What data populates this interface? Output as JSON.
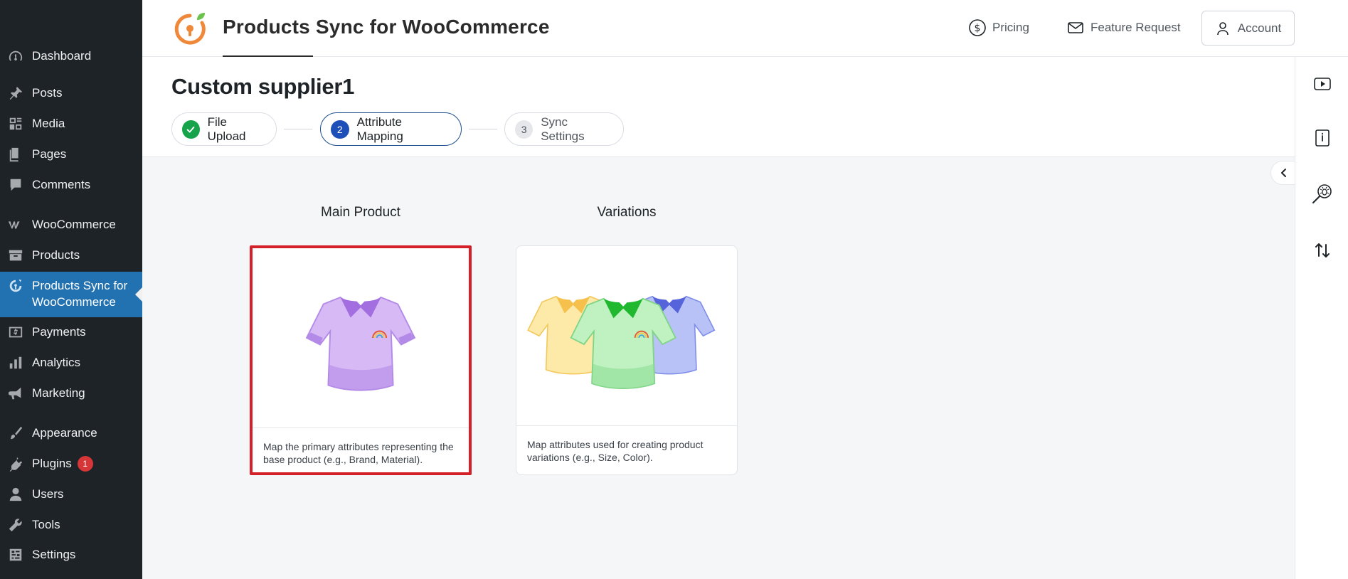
{
  "sidebar": {
    "items": [
      {
        "label": "Dashboard",
        "icon": "dashboard-icon"
      },
      {
        "label": "Posts",
        "icon": "pin-icon"
      },
      {
        "label": "Media",
        "icon": "media-icon"
      },
      {
        "label": "Pages",
        "icon": "pages-icon"
      },
      {
        "label": "Comments",
        "icon": "comment-icon"
      },
      {
        "label": "WooCommerce",
        "icon": "woo-icon"
      },
      {
        "label": "Products",
        "icon": "archive-icon"
      },
      {
        "label": "Products Sync for WooCommerce",
        "icon": "sync-icon",
        "active": true
      },
      {
        "label": "Payments",
        "icon": "payments-icon"
      },
      {
        "label": "Analytics",
        "icon": "analytics-icon"
      },
      {
        "label": "Marketing",
        "icon": "megaphone-icon"
      },
      {
        "label": "Appearance",
        "icon": "brush-icon"
      },
      {
        "label": "Plugins",
        "icon": "plugin-icon",
        "badge": "1"
      },
      {
        "label": "Users",
        "icon": "user-icon"
      },
      {
        "label": "Tools",
        "icon": "wrench-icon"
      },
      {
        "label": "Settings",
        "icon": "settings-icon"
      }
    ]
  },
  "header": {
    "title": "Products Sync for WooCommerce",
    "pricing": "Pricing",
    "feature_request": "Feature Request",
    "account": "Account"
  },
  "page": {
    "title": "Custom supplier1"
  },
  "steps": [
    {
      "num": "",
      "label": "File Upload",
      "state": "done"
    },
    {
      "num": "2",
      "label": "Attribute Mapping",
      "state": "current"
    },
    {
      "num": "3",
      "label": "Sync Settings",
      "state": "todo"
    }
  ],
  "options": {
    "main": {
      "heading": "Main Product",
      "caption": "Map the primary attributes representing the base product (e.g., Brand, Material).",
      "selected": true
    },
    "variations": {
      "heading": "Variations",
      "caption": "Map attributes used for creating product variations (e.g., Size, Color).",
      "selected": false
    }
  },
  "colors": {
    "wp_sidebar": "#1d2327",
    "wp_active": "#2271b1",
    "brand_orange": "#f0883a",
    "selected_border": "#d32029",
    "step_current": "#1d4fb8",
    "step_done": "#16a34a"
  },
  "rail": {
    "icons": [
      "video-icon",
      "book-icon",
      "bug-search-icon",
      "transfer-icon"
    ]
  }
}
